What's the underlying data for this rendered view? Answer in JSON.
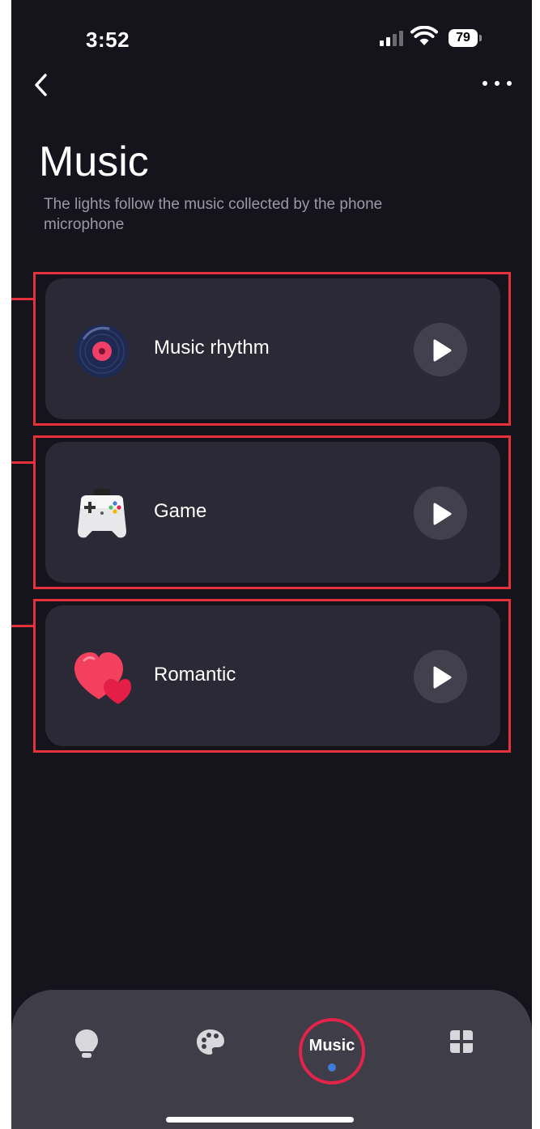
{
  "status_bar": {
    "time": "3:52",
    "battery": "79"
  },
  "header": {
    "title": "Music",
    "subtitle": "The lights follow the music collected by the phone microphone"
  },
  "modes": [
    {
      "label": "Music rhythm",
      "icon": "vinyl-record-icon"
    },
    {
      "label": "Game",
      "icon": "gamepad-icon"
    },
    {
      "label": "Romantic",
      "icon": "hearts-icon"
    }
  ],
  "tab_bar": {
    "tabs": [
      {
        "name": "lightbulb-icon"
      },
      {
        "name": "palette-icon"
      },
      {
        "label": "Music",
        "selected": true
      },
      {
        "name": "apps-grid-icon"
      }
    ]
  },
  "colors": {
    "background": "#15141c",
    "card": "#2a2935",
    "highlight_frame": "#e53139",
    "tab_bar": "#3f3e48",
    "active_ring": "#e3234a",
    "active_dot": "#3f7bd8"
  }
}
